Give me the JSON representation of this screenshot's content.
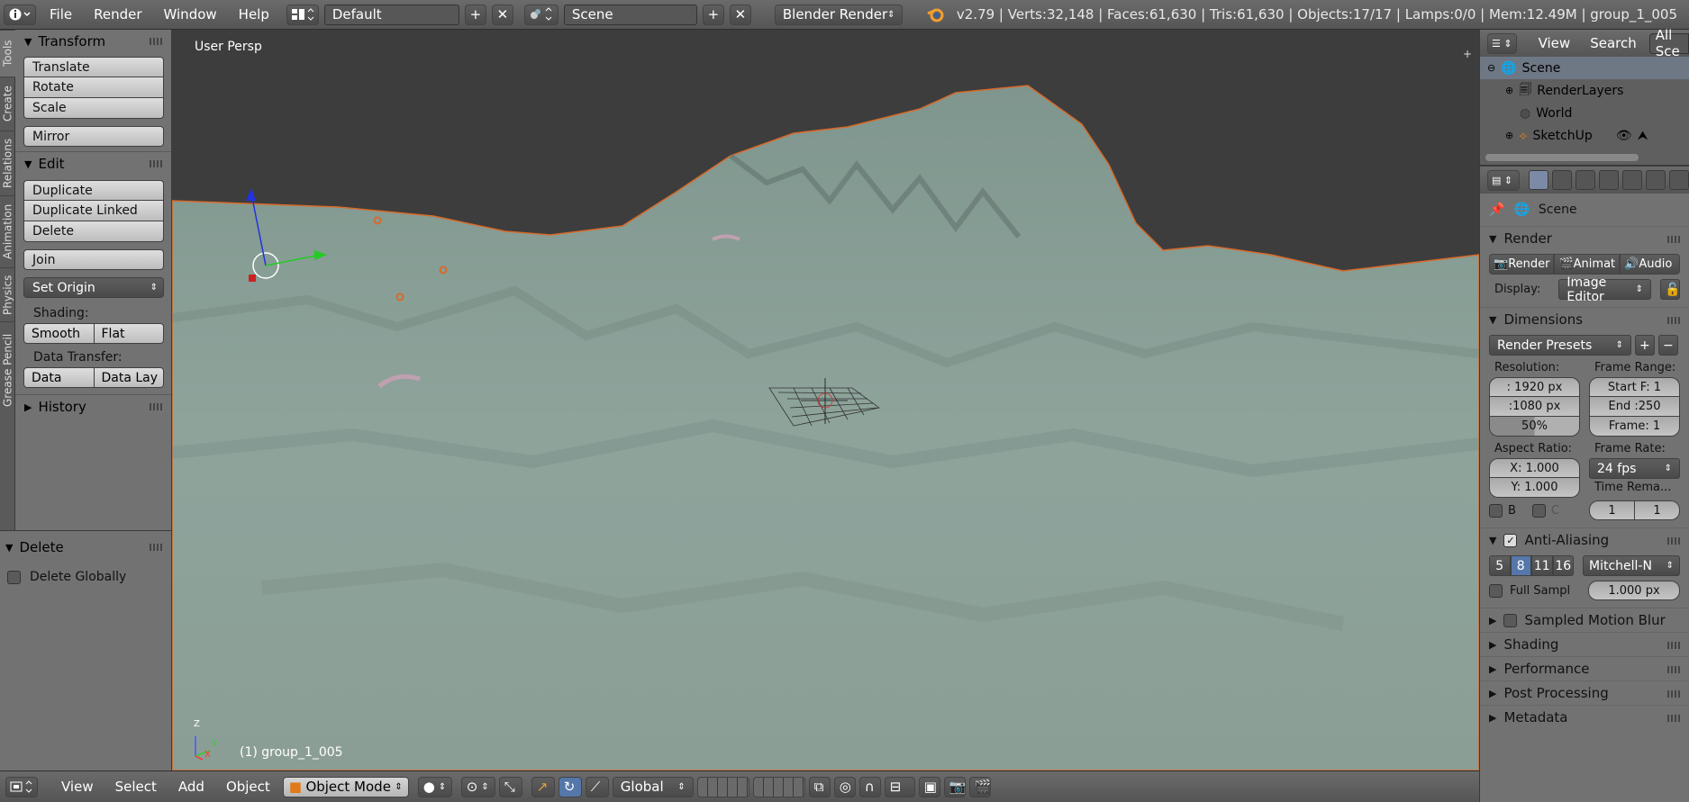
{
  "topbar": {
    "info_icon": "info-icon",
    "menus": [
      "File",
      "Render",
      "Window",
      "Help"
    ],
    "layout": "Default",
    "scene": "Scene",
    "engine": "Blender Render",
    "stats": "v2.79 | Verts:32,148 | Faces:61,630 | Tris:61,630 | Objects:17/17 | Lamps:0/0 | Mem:12.49M | group_1_005"
  },
  "tool_tabs": [
    "Tools",
    "Create",
    "Relations",
    "Animation",
    "Physics",
    "Grease Pencil"
  ],
  "tools": {
    "transform": {
      "title": "Transform",
      "buttons": [
        "Translate",
        "Rotate",
        "Scale",
        "Mirror"
      ]
    },
    "edit": {
      "title": "Edit",
      "buttons": [
        "Duplicate",
        "Duplicate Linked",
        "Delete",
        "Join"
      ],
      "set_origin": "Set Origin",
      "shading_label": "Shading:",
      "shading": [
        "Smooth",
        "Flat"
      ],
      "data_transfer_label": "Data Transfer:",
      "data_transfer": [
        "Data",
        "Data Lay"
      ]
    },
    "history": "History"
  },
  "operator": {
    "title": "Delete",
    "option": "Delete Globally"
  },
  "viewport": {
    "view_name": "User Persp",
    "object_label": "(1) group_1_005",
    "axis_x": "X",
    "axis_y": "Y",
    "axis_z": "Z"
  },
  "bottombar": {
    "menus": [
      "View",
      "Select",
      "Add",
      "Object"
    ],
    "mode": "Object Mode",
    "orientation": "Global"
  },
  "outliner": {
    "menus": [
      "View",
      "Search"
    ],
    "filter": "All Sce",
    "rows": [
      "Scene",
      "RenderLayers",
      "World",
      "SketchUp"
    ]
  },
  "properties": {
    "context": "Scene",
    "render": {
      "title": "Render",
      "buttons": [
        "Render",
        "Animat",
        "Audio"
      ],
      "display_label": "Display:",
      "display": "Image Editor"
    },
    "dimensions": {
      "title": "Dimensions",
      "presets": "Render Presets",
      "resolution_label": "Resolution:",
      "res_x": ": 1920 px",
      "res_y": ":1080 px",
      "res_pct": "50%",
      "frame_range_label": "Frame Range:",
      "start": "Start F: 1",
      "end": "End :250",
      "frame": "Frame: 1",
      "aspect_label": "Aspect Ratio:",
      "aspect_x": "X:  1.000",
      "aspect_y": "Y:  1.000",
      "frame_rate_label": "Frame Rate:",
      "frame_rate": "24 fps",
      "time_remap_label": "Time Rema...",
      "b_label": "B",
      "c_label": "C",
      "remap_old": "1",
      "remap_new": "1"
    },
    "aa": {
      "title": "Anti-Aliasing",
      "samples": [
        "5",
        "8",
        "11",
        "16"
      ],
      "selected": "8",
      "filter": "Mitchell-N",
      "full_sample": "Full Sampl",
      "size": "1.000 px"
    },
    "sections": [
      "Sampled Motion Blur",
      "Shading",
      "Performance",
      "Post Processing",
      "Metadata"
    ]
  }
}
